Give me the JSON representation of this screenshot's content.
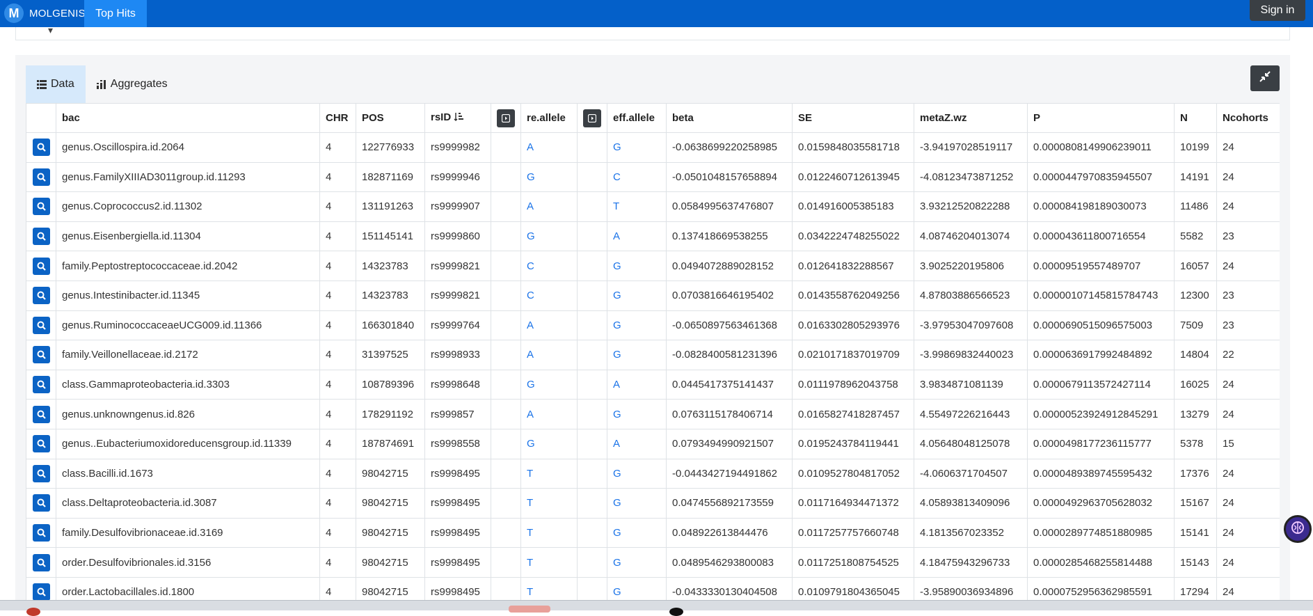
{
  "navbar": {
    "brand_mark": "M",
    "brand_name": "MOLGENIS",
    "active_tab": "Top Hits",
    "sign_in": "Sign in"
  },
  "tabs": [
    {
      "label": "Data",
      "icon": "list-icon",
      "active": true
    },
    {
      "label": "Aggregates",
      "icon": "bar-chart-icon",
      "active": false
    }
  ],
  "table": {
    "columns": [
      "",
      "bac",
      "CHR",
      "POS",
      "rsID",
      "",
      "re.allele",
      "",
      "eff.allele",
      "beta",
      "SE",
      "metaZ.wz",
      "P",
      "N",
      "Ncohorts"
    ],
    "sorted_column": "rsID",
    "rows": [
      [
        "genus.Oscillospira.id.2064",
        "4",
        "122776933",
        "rs9999982",
        "A",
        "G",
        "-0.0638699220258985",
        "0.0159848035581718",
        "-3.94197028519117",
        "0.0000808149906239011",
        "10199",
        "24"
      ],
      [
        "genus.FamilyXIIIAD3011group.id.11293",
        "4",
        "182871169",
        "rs9999946",
        "G",
        "C",
        "-0.0501048157658894",
        "0.0122460712613945",
        "-4.08123473871252",
        "0.0000447970835945507",
        "14191",
        "24"
      ],
      [
        "genus.Coprococcus2.id.11302",
        "4",
        "131191263",
        "rs9999907",
        "A",
        "T",
        "0.0584995637476807",
        "0.014916005385183",
        "3.93212520822288",
        "0.000084198189030073",
        "11486",
        "24"
      ],
      [
        "genus.Eisenbergiella.id.11304",
        "4",
        "151145141",
        "rs9999860",
        "G",
        "A",
        "0.137418669538255",
        "0.0342224748255022",
        "4.08746204013074",
        "0.000043611800716554",
        "5582",
        "23"
      ],
      [
        "family.Peptostreptococcaceae.id.2042",
        "4",
        "14323783",
        "rs9999821",
        "C",
        "G",
        "0.0494072889028152",
        "0.012641832288567",
        "3.9025220195806",
        "0.00009519557489707",
        "16057",
        "24"
      ],
      [
        "genus.Intestinibacter.id.11345",
        "4",
        "14323783",
        "rs9999821",
        "C",
        "G",
        "0.0703816646195402",
        "0.0143558762049256",
        "4.87803886566523",
        "0.00000107145815784743",
        "12300",
        "23"
      ],
      [
        "genus.RuminococcaceaeUCG009.id.11366",
        "4",
        "166301840",
        "rs9999764",
        "A",
        "G",
        "-0.0650897563461368",
        "0.0163302805293976",
        "-3.97953047097608",
        "0.0000690515096575003",
        "7509",
        "23"
      ],
      [
        "family.Veillonellaceae.id.2172",
        "4",
        "31397525",
        "rs9998933",
        "A",
        "G",
        "-0.0828400581231396",
        "0.0210171837019709",
        "-3.99869832440023",
        "0.0000636917992484892",
        "14804",
        "22"
      ],
      [
        "class.Gammaproteobacteria.id.3303",
        "4",
        "108789396",
        "rs9998648",
        "G",
        "A",
        "0.0445417375141437",
        "0.0111978962043758",
        "3.9834871081139",
        "0.0000679113572427114",
        "16025",
        "24"
      ],
      [
        "genus.unknowngenus.id.826",
        "4",
        "178291192",
        "rs999857",
        "A",
        "G",
        "0.0763115178406714",
        "0.0165827418287457",
        "4.55497226216443",
        "0.00000523924912845291",
        "13279",
        "24"
      ],
      [
        "genus..Eubacteriumoxidoreducensgroup.id.11339",
        "4",
        "187874691",
        "rs9998558",
        "G",
        "A",
        "0.0793494990921507",
        "0.0195243784119441",
        "4.05648048125078",
        "0.0000498177236115777",
        "5378",
        "15"
      ],
      [
        "class.Bacilli.id.1673",
        "4",
        "98042715",
        "rs9998495",
        "T",
        "G",
        "-0.0443427194491862",
        "0.0109527804817052",
        "-4.0606371704507",
        "0.0000489389745595432",
        "17376",
        "24"
      ],
      [
        "class.Deltaproteobacteria.id.3087",
        "4",
        "98042715",
        "rs9998495",
        "T",
        "G",
        "0.0474556892173559",
        "0.0117164934471372",
        "4.05893813409096",
        "0.0000492963705628032",
        "15167",
        "24"
      ],
      [
        "family.Desulfovibrionaceae.id.3169",
        "4",
        "98042715",
        "rs9998495",
        "T",
        "G",
        "0.048922613844476",
        "0.0117257757660748",
        "4.1813567023352",
        "0.0000289774851880985",
        "15141",
        "24"
      ],
      [
        "order.Desulfovibrionales.id.3156",
        "4",
        "98042715",
        "rs9998495",
        "T",
        "G",
        "0.0489546293800083",
        "0.0117251808754525",
        "4.18475943296733",
        "0.0000285468255814488",
        "15143",
        "24"
      ],
      [
        "order.Lactobacillales.id.1800",
        "4",
        "98042715",
        "rs9998495",
        "T",
        "G",
        "-0.0433330130404508",
        "0.0109791804365045",
        "-3.95890036934896",
        "0.0000752956362985591",
        "17294",
        "24"
      ]
    ]
  }
}
